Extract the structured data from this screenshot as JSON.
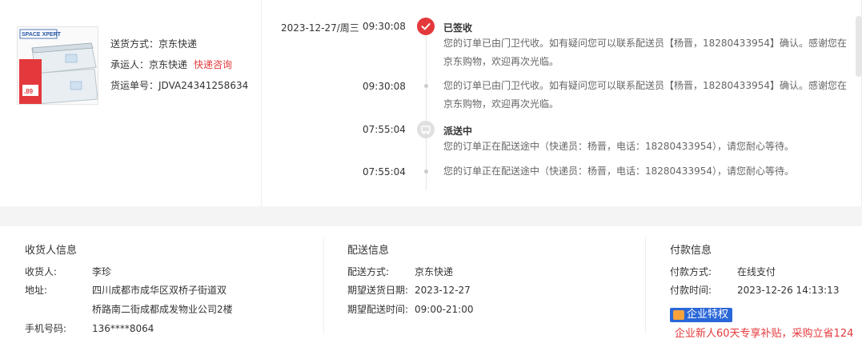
{
  "shipping": {
    "method_label": "送货方式：",
    "method_value": "京东快递",
    "carrier_label": "承运人：",
    "carrier_value": "京东快递",
    "carrier_link": "快递咨询",
    "tracking_label": "货运单号：",
    "tracking_value": "JDVA24341258634",
    "thumbnail": {
      "brand": "SPACE XPERT",
      "price": ".89"
    }
  },
  "timeline": {
    "date": "2023-12-27/周三",
    "events": [
      {
        "time": "09:30:08",
        "status": "已签收",
        "message": "您的订单已由门卫代收。如有疑问您可以联系配送员【杨晋，18280433954】确认。感谢您在京东购物，欢迎再次光临。",
        "icon": "check-icon"
      },
      {
        "time": "09:30:08",
        "status": "",
        "message": "您的订单已由门卫代收。如有疑问您可以联系配送员【杨晋，18280433954】确认。感谢您在京东购物，欢迎再次光临。",
        "icon": "dot-icon"
      },
      {
        "time": "07:55:04",
        "status": "派送中",
        "message": "您的订单正在配送途中（快递员：杨晋，电话：18280433954），请您耐心等待。",
        "icon": "delivery-icon"
      },
      {
        "time": "07:55:04",
        "status": "",
        "message": "您的订单正在配送途中（快递员：杨晋，电话：18280433954），请您耐心等待。",
        "icon": "dot-icon"
      }
    ]
  },
  "receiver": {
    "title": "收货人信息",
    "name_label": "收货人:",
    "name_value": "李珍",
    "address_label": "地址:",
    "address_line1": "四川成都市成华区双桥子街道双",
    "address_line2": "桥路南二街成都成发物业公司2楼",
    "phone_label": "手机号码:",
    "phone_value": "136****8064"
  },
  "delivery": {
    "title": "配送信息",
    "method_label": "配送方式:",
    "method_value": "京东快递",
    "date_label": "期望送货日期:",
    "date_value": "2023-12-27",
    "window_label": "期望配送时间:",
    "window_value": "09:00-21:00"
  },
  "payment": {
    "title": "付款信息",
    "method_label": "付款方式:",
    "method_value": "在线支付",
    "time_label": "付款时间:",
    "time_value": "2023-12-26 14:13:13",
    "badge": "企业特权",
    "promo": "企业新人60天专享补贴，采购立省124"
  },
  "colors": {
    "accent": "#e4393c",
    "badge": "#2a67d8",
    "badge_icon": "#f7a23b"
  }
}
